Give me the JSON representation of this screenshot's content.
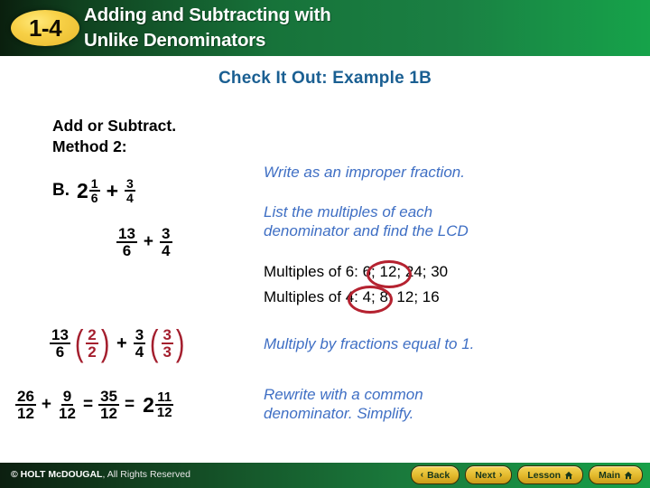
{
  "header": {
    "badge": "1-4",
    "title_line1": "Adding and Subtracting with",
    "title_line2": "Unlike Denominators",
    "green": "#17733a",
    "badge_color": "#f7d046"
  },
  "subtitle": "Check It Out: Example 1B",
  "prompt": {
    "line1": "Add or Subtract.",
    "line2": "Method 2:"
  },
  "problem": {
    "label": "B.",
    "mixed_whole": "2",
    "mixed_num": "1",
    "mixed_den": "6",
    "plus": "+",
    "second_num": "3",
    "second_den": "4"
  },
  "improper_row": {
    "first_num": "13",
    "first_den": "6",
    "plus": "+",
    "second_num": "3",
    "second_den": "4"
  },
  "multiply_row": {
    "first_num": "13",
    "first_den": "6",
    "factor1_num": "2",
    "factor1_den": "2",
    "plus": "+",
    "second_num": "3",
    "second_den": "4",
    "factor2_num": "3",
    "factor2_den": "3",
    "paren_open": "(",
    "paren_close": ")",
    "accent": "#a41f2e"
  },
  "final_row": {
    "first_num": "26",
    "first_den": "12",
    "plus": "+",
    "second_num": "9",
    "second_den": "12",
    "equals1": "=",
    "sum_num": "35",
    "sum_den": "12",
    "equals2": "=",
    "mixed_whole": "2",
    "mixed_num": "11",
    "mixed_den": "12"
  },
  "notes": {
    "improper": "Write as an improper fraction.",
    "lcd_line1": "List the multiples of each",
    "lcd_line2": "denominator and find the LCD",
    "multiply": "Multiply by fractions equal to 1.",
    "rewrite_line1": "Rewrite with a common",
    "rewrite_line2": "denominator. Simplify.",
    "color": "#3f6fc4"
  },
  "multiples": {
    "six": "Multiples of 6: 6; 12; 24; 30",
    "four": "Multiples of 4: 4; 8; 12; 16",
    "circle_color": "#b52230"
  },
  "footer": {
    "copyright_strong": "© HOLT McDOUGAL",
    "copyright_rest": ", All Rights Reserved",
    "buttons": [
      {
        "label": "Back",
        "icon": "chevron-left-icon",
        "glyph": "‹"
      },
      {
        "label": "Next",
        "icon": "chevron-right-icon",
        "glyph": "›"
      },
      {
        "label": "Lesson",
        "icon": "home-icon",
        "glyph": ""
      },
      {
        "label": "Main",
        "icon": "home-icon",
        "glyph": ""
      }
    ]
  }
}
